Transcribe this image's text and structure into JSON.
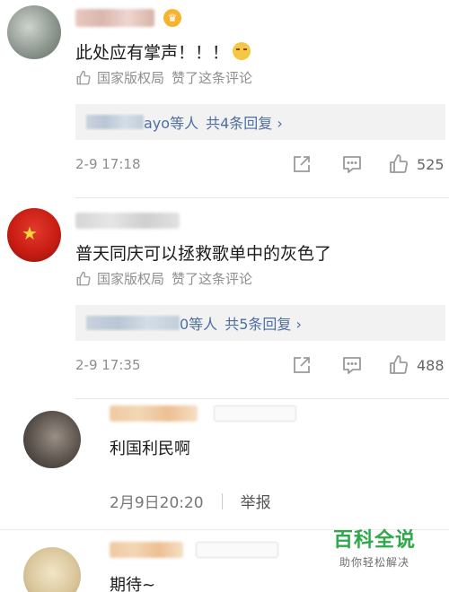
{
  "comments": [
    {
      "text": "此处应有掌声！！！",
      "liked_by": "国家版权局",
      "liked_label": "赞了这条评论",
      "reply_suffix": "ayo等人",
      "reply_count": "共4条回复 ›",
      "time": "2-9 17:18",
      "likes": "525"
    },
    {
      "text": "普天同庆可以拯救歌单中的灰色了",
      "liked_by": "国家版权局",
      "liked_label": "赞了这条评论",
      "reply_suffix": "0等人",
      "reply_count": "共5条回复 ›",
      "time": "2-9 17:35",
      "likes": "488"
    }
  ],
  "sub_comments": [
    {
      "text": "利国利民啊",
      "time": "2月9日20:20",
      "report": "举报"
    },
    {
      "text": "期待~"
    }
  ],
  "watermark": {
    "title": "百科全说",
    "subtitle": "助你轻松解决"
  },
  "icons": {
    "crown": "crown-icon",
    "thumb": "thumbs-up-icon",
    "share": "share-icon",
    "comment": "comment-icon",
    "like": "like-icon"
  },
  "colors": {
    "link": "#4e6ea0",
    "muted": "#8e8e8e",
    "watermark": "#2ea84a"
  }
}
